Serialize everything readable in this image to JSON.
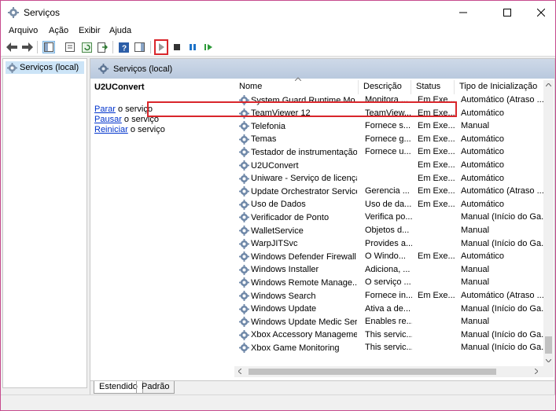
{
  "window": {
    "title": "Serviços",
    "accent": "#c64b8e",
    "highlight_color": "#d9262b"
  },
  "menu": [
    "Arquivo",
    "Ação",
    "Exibir",
    "Ajuda"
  ],
  "tree": {
    "root_label": "Serviços (local)"
  },
  "panel": {
    "header": "Serviços (local)",
    "selected_service": "U2UConvert",
    "actions": [
      {
        "link": "Parar",
        "rest": " o serviço"
      },
      {
        "link": "Pausar",
        "rest": " o serviço"
      },
      {
        "link": "Reiniciar",
        "rest": " o serviço"
      }
    ]
  },
  "table": {
    "columns": [
      "Nome",
      "Descrição",
      "Status",
      "Tipo de Inicialização"
    ],
    "rows": [
      {
        "name": "System Guard Runtime Mo...",
        "desc": "Monitora ...",
        "status": "Em Exe...",
        "start": "Automático (Atraso ..."
      },
      {
        "name": "TeamViewer 12",
        "desc": "TeamView...",
        "status": "Em Exe...",
        "start": "Automático"
      },
      {
        "name": "Telefonia",
        "desc": "Fornece s...",
        "status": "Em Exe...",
        "start": "Manual"
      },
      {
        "name": "Temas",
        "desc": "Fornece g...",
        "status": "Em Exe...",
        "start": "Automático"
      },
      {
        "name": "Testador de instrumentação...",
        "desc": "Fornece u...",
        "status": "Em Exe...",
        "start": "Automático"
      },
      {
        "name": "U2UConvert",
        "desc": "",
        "status": "Em Exe...",
        "start": "Automático"
      },
      {
        "name": "Uniware - Serviço de licenças",
        "desc": "",
        "status": "Em Exe...",
        "start": "Automático"
      },
      {
        "name": "Update Orchestrator Service",
        "desc": "Gerencia ...",
        "status": "Em Exe...",
        "start": "Automático (Atraso ..."
      },
      {
        "name": "Uso de Dados",
        "desc": "Uso de da...",
        "status": "Em Exe...",
        "start": "Automático"
      },
      {
        "name": "Verificador de Ponto",
        "desc": "Verifica po...",
        "status": "",
        "start": "Manual (Início do Ga..."
      },
      {
        "name": "WalletService",
        "desc": "Objetos d...",
        "status": "",
        "start": "Manual"
      },
      {
        "name": "WarpJITSvc",
        "desc": "Provides a...",
        "status": "",
        "start": "Manual (Início do Ga..."
      },
      {
        "name": "Windows Defender Firewall",
        "desc": "O Windo...",
        "status": "Em Exe...",
        "start": "Automático"
      },
      {
        "name": "Windows Installer",
        "desc": "Adiciona, ...",
        "status": "",
        "start": "Manual"
      },
      {
        "name": "Windows Remote Manage...",
        "desc": "O serviço ...",
        "status": "",
        "start": "Manual"
      },
      {
        "name": "Windows Search",
        "desc": "Fornece in...",
        "status": "Em Exe...",
        "start": "Automático (Atraso ..."
      },
      {
        "name": "Windows Update",
        "desc": "Ativa a de...",
        "status": "",
        "start": "Manual (Início do Ga..."
      },
      {
        "name": "Windows Update Medic Ser...",
        "desc": "Enables re...",
        "status": "",
        "start": "Manual"
      },
      {
        "name": "Xbox Accessory Manageme...",
        "desc": "This servic...",
        "status": "",
        "start": "Manual (Início do Ga..."
      },
      {
        "name": "Xbox Game Monitoring",
        "desc": "This servic...",
        "status": "",
        "start": "Manual (Início do Ga..."
      }
    ]
  },
  "tabs": [
    "Estendido",
    "Padrão"
  ],
  "icons": {
    "app": "gear-icon",
    "toolbar": [
      "back-arrow-icon",
      "forward-arrow-icon",
      "console-tree-icon",
      "properties-icon",
      "refresh-icon",
      "export-list-icon",
      "help-icon",
      "action-pane-icon",
      "start-service-icon",
      "stop-service-icon",
      "pause-service-icon",
      "restart-service-icon"
    ]
  }
}
